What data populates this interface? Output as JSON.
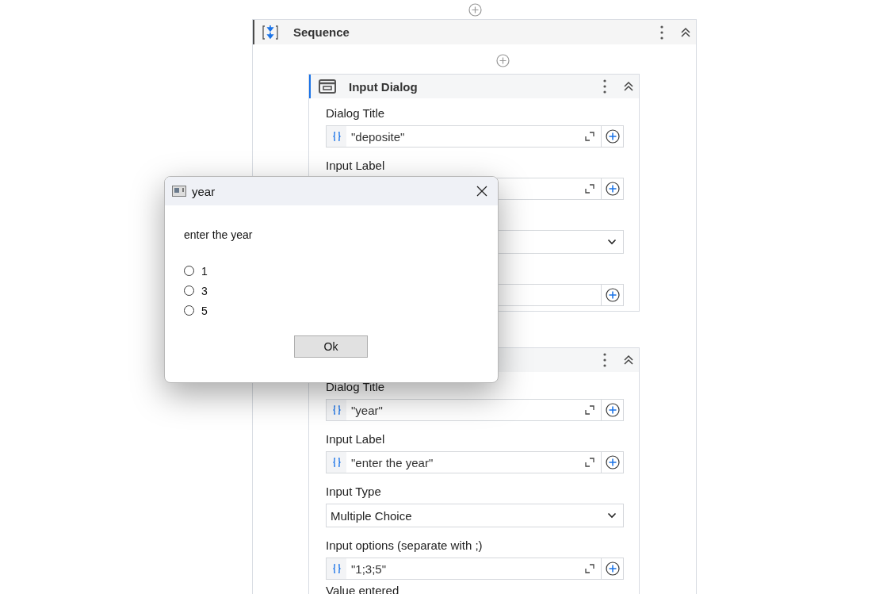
{
  "sequence": {
    "title": "Sequence",
    "cards": [
      {
        "title": "Input Dialog",
        "fields": [
          {
            "kind": "expression",
            "label": "Dialog Title",
            "value": "\"deposite\"",
            "expandable": true
          },
          {
            "kind": "expression",
            "label": "Input Label",
            "expandable": true
          },
          {
            "kind": "dropdown"
          },
          {
            "kind": "expression",
            "expandable": false
          }
        ]
      },
      {
        "fields": [
          {
            "kind": "expression",
            "label": "Dialog Title",
            "value": "\"year\"",
            "expandable": true
          },
          {
            "kind": "expression",
            "label": "Input Label",
            "value": "\"enter the year\"",
            "expandable": true
          },
          {
            "kind": "dropdown",
            "label": "Input Type",
            "value": "Multiple Choice"
          },
          {
            "kind": "expression",
            "label": "Input options (separate with ;)",
            "value": "\"1;3;5\"",
            "expandable": true
          },
          {
            "kind": "label",
            "label": "Value entered"
          }
        ]
      }
    ]
  },
  "dialog": {
    "title": "year",
    "prompt": "enter the year",
    "options": [
      {
        "label": "1",
        "selected": false
      },
      {
        "label": "3",
        "selected": false
      },
      {
        "label": "5",
        "selected": false
      }
    ],
    "button": "Ok"
  }
}
